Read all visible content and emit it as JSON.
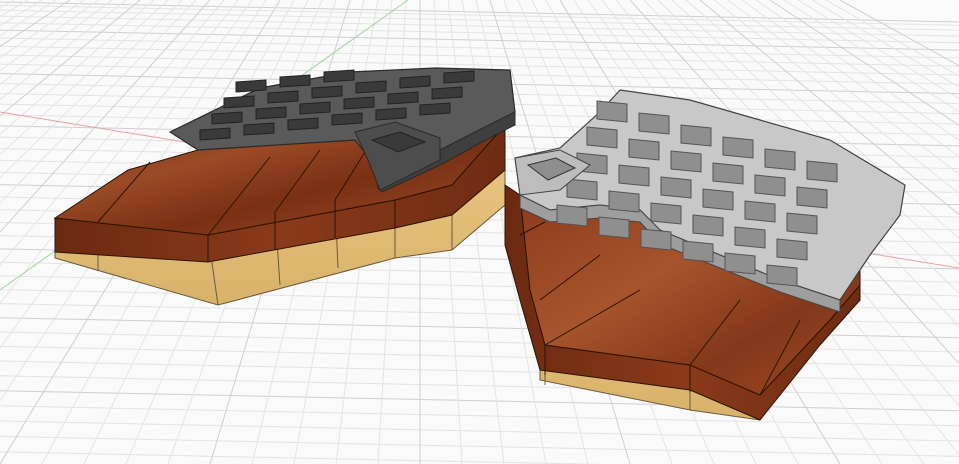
{
  "viewport": {
    "background": "#fafafa",
    "grid_minor_color": "#e4e4e4",
    "grid_major_color": "#cfcfcf",
    "x_axis_color": "#e8a0a0",
    "y_axis_color": "#9ad69a"
  },
  "models": [
    {
      "id": "left-half",
      "plate_color": "#5c5c5c",
      "plate_dark": "#3e3e3e",
      "wood_color": "#8e3e1e",
      "wood_dark": "#6e2c12",
      "base_color": "#e3c07a"
    },
    {
      "id": "right-half",
      "plate_color": "#c9c9c9",
      "plate_dark": "#9d9d9d",
      "wood_color": "#9a4626",
      "wood_dark": "#6e2c12",
      "base_color": "#e5c27c"
    }
  ]
}
